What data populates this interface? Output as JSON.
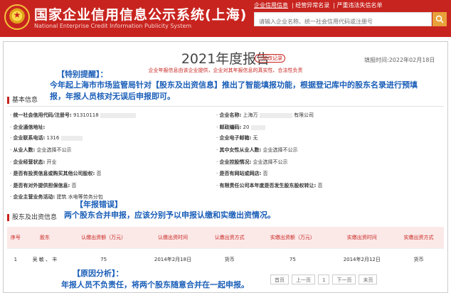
{
  "header": {
    "site_title": "国家企业信用信息公示系统(上海)",
    "site_subtitle": "National Enterprise Credit Information Publicity System",
    "nav": [
      "企业信用信息",
      "经营异常名录",
      "严重违法失信名单"
    ],
    "search_placeholder": "请输入企业名称、统一社会信用代码或注册号"
  },
  "report": {
    "title": "2021年度报告",
    "stamp": "已修改记录",
    "fill_date": "填报时间:2022年02月18日",
    "note": "企业年报信息由该企业提供，企业对其年报信息的真实性、合法性负责"
  },
  "annotations": {
    "tip_label": "【特别提醒】：",
    "tip_body": "今年起上海市市场监管局针对【股东及出资信息】推出了智能填报功能，根据登记库中的股东名录进行预填报，年报人员核对无误后申报即可。",
    "error_label": "【年报错误】",
    "error_body": "两个股东合并申报，应该分别予以申报认缴和实缴出资情况。",
    "cause_label": "【原因分析】：",
    "cause_body": "年报人员不负责任，将两个股东随意合并在一起申报。"
  },
  "basic": {
    "section_title": "基本信息",
    "left": [
      {
        "label": "统一社会信用代码/注册号:",
        "value": "91310118"
      },
      {
        "label": "企业通信地址:",
        "value": ""
      },
      {
        "label": "企业联系电话:",
        "value": "1316"
      },
      {
        "label": "从业人数:",
        "value": "企业选择不公示"
      },
      {
        "label": "企业经营状态:",
        "value": "开业"
      },
      {
        "label": "是否有投资信息或购买其他公司股权:",
        "value": "否"
      },
      {
        "label": "是否有对外提供担保信息:",
        "value": "否"
      },
      {
        "label": "企业主营业务活动:",
        "value": "建筑 水电等劳务分包"
      }
    ],
    "right": [
      {
        "label": "企业名称:",
        "value": "上海万",
        "suffix": "有限公司"
      },
      {
        "label": "邮政编码:",
        "value": "20"
      },
      {
        "label": "企业电子邮箱:",
        "value": "无"
      },
      {
        "label": "其中女性从业人数:",
        "value": "企业选择不公示"
      },
      {
        "label": "企业控股情况:",
        "value": "企业选择不公示"
      },
      {
        "label": "是否有网站或网店:",
        "value": "否"
      },
      {
        "label": "有限责任公司本年度是否发生股东股权转让:",
        "value": "否"
      }
    ]
  },
  "shareholders": {
    "section_title": "股东及出资信息",
    "columns": [
      "序号",
      "股东",
      "认缴出资额（万元）",
      "认缴出资时间",
      "认缴出资方式",
      "实缴出资额（万元）",
      "实缴出资时间",
      "实缴出资方式"
    ],
    "rows": [
      [
        "1",
        "吴  敏  、  丰",
        "75",
        "2014年2月18日",
        "货币",
        "75",
        "2014年2月12日",
        "货币"
      ]
    ]
  },
  "pager": [
    "首页",
    "上一页",
    "1",
    "下一页",
    "末页"
  ]
}
